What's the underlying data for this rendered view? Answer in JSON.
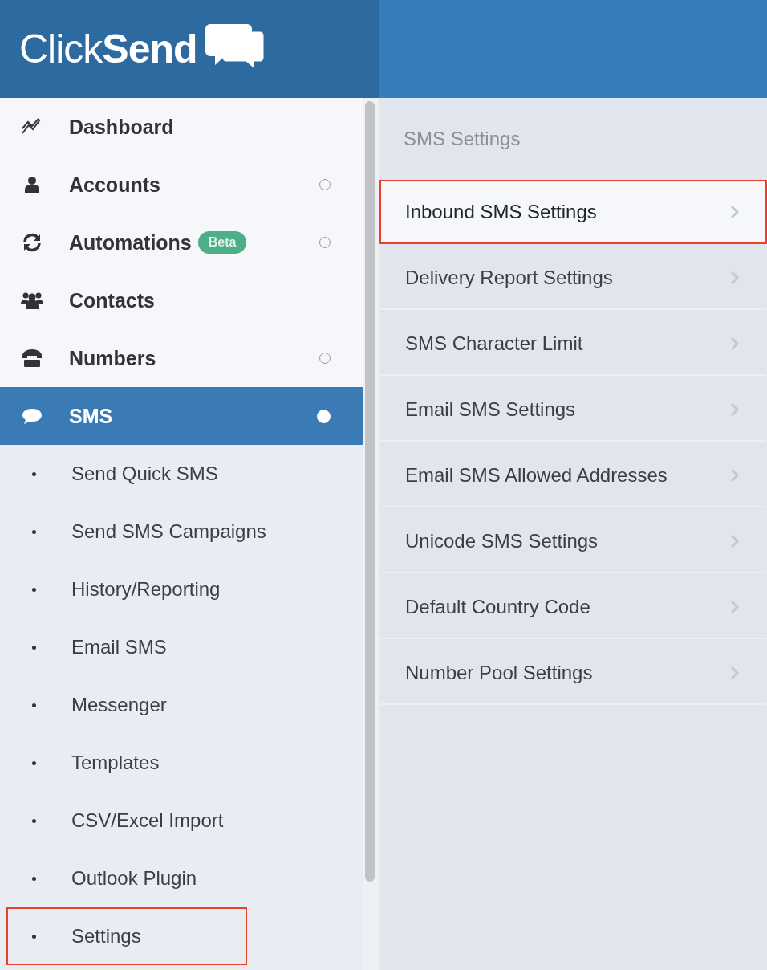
{
  "logo": {
    "text": "Click**Send**"
  },
  "sidebar": {
    "items": [
      {
        "kind": "main",
        "label": "Dashboard",
        "selected": false
      },
      {
        "kind": "main",
        "label": "Accounts",
        "expanded": false,
        "selected": false
      },
      {
        "kind": "main",
        "label": "Automations",
        "badge": "Beta",
        "expanded": false,
        "selected": false
      },
      {
        "kind": "main",
        "label": "Contacts",
        "selected": false
      },
      {
        "kind": "main",
        "label": "Numbers",
        "expanded": false,
        "selected": false
      },
      {
        "kind": "main",
        "label": "SMS",
        "expanded": true,
        "selected": true
      },
      {
        "kind": "sub",
        "label": "Send Quick SMS",
        "highlighted": false
      },
      {
        "kind": "sub",
        "label": "Send SMS Campaigns",
        "highlighted": false
      },
      {
        "kind": "sub",
        "label": "History/Reporting",
        "highlighted": false
      },
      {
        "kind": "sub",
        "label": "Email SMS",
        "highlighted": false
      },
      {
        "kind": "sub",
        "label": "Messenger",
        "highlighted": false
      },
      {
        "kind": "sub",
        "label": "Templates",
        "highlighted": false
      },
      {
        "kind": "sub",
        "label": "CSV/Excel Import",
        "highlighted": false
      },
      {
        "kind": "sub",
        "label": "Outlook Plugin",
        "highlighted": false
      },
      {
        "kind": "sub",
        "label": "Settings",
        "highlighted": true
      }
    ]
  },
  "settings": {
    "title": "SMS Settings",
    "items": [
      {
        "label": "Inbound SMS Settings",
        "selected": true,
        "highlighted": true
      },
      {
        "label": "Delivery Report Settings",
        "selected": false,
        "highlighted": false
      },
      {
        "label": "SMS Character Limit",
        "selected": false,
        "highlighted": false
      },
      {
        "label": "Email SMS Settings",
        "selected": false,
        "highlighted": false
      },
      {
        "label": "Email SMS Allowed Addresses",
        "selected": false,
        "highlighted": false
      },
      {
        "label": "Unicode SMS Settings",
        "selected": false,
        "highlighted": false
      },
      {
        "label": "Default Country Code",
        "selected": false,
        "highlighted": false
      },
      {
        "label": "Number Pool Settings",
        "selected": false,
        "highlighted": false
      }
    ]
  }
}
